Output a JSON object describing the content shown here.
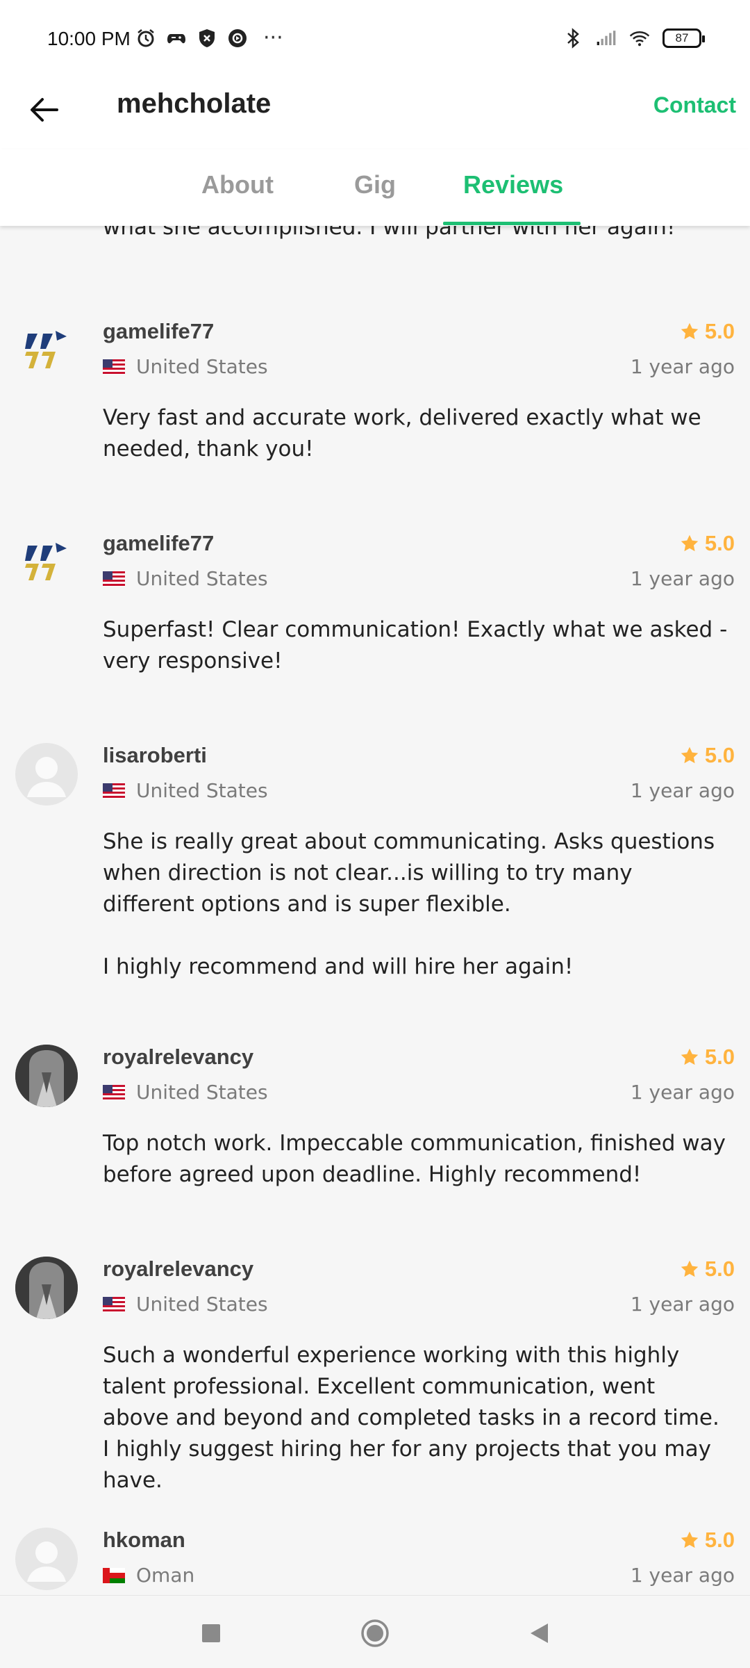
{
  "status_bar": {
    "time": "10:00 PM",
    "battery": "87"
  },
  "header": {
    "title": "mehcholate",
    "contact_label": "Contact"
  },
  "tabs": [
    {
      "label": "About"
    },
    {
      "label": "Gig"
    },
    {
      "label": "Reviews"
    }
  ],
  "previous_review_tail": "what she accomplished. I will partner with her again!",
  "reviews": [
    {
      "username": "gamelife77",
      "country": "United States",
      "rating": "5.0",
      "time": "1 year ago",
      "text": "Very fast and accurate work, delivered exactly what we needed, thank you!"
    },
    {
      "username": "gamelife77",
      "country": "United States",
      "rating": "5.0",
      "time": "1 year ago",
      "text": "Superfast!  Clear communication!  Exactly what we asked - very responsive!"
    },
    {
      "username": "lisaroberti",
      "country": "United States",
      "rating": "5.0",
      "time": "1 year ago",
      "text": "She is really great about communicating.   Asks questions when direction is not clear...is willing to try many different options and is super flexible.\n\nI highly recommend and will hire her again!"
    },
    {
      "username": "royalrelevancy",
      "country": "United States",
      "rating": "5.0",
      "time": "1 year ago",
      "text": "Top notch work. Impeccable communication, finished way before agreed upon deadline. Highly recommend!"
    },
    {
      "username": "royalrelevancy",
      "country": "United States",
      "rating": "5.0",
      "time": "1 year ago",
      "text": "Such a wonderful experience working with this highly talent professional. Excellent communication, went above and beyond and completed tasks in a record time. I highly suggest hiring her for any projects that you may have."
    },
    {
      "username": "hkoman",
      "country": "Oman",
      "rating": "5.0",
      "time": "1 year ago",
      "text": ""
    }
  ],
  "colors": {
    "accent": "#1dbf73",
    "star": "#ffb33e"
  }
}
